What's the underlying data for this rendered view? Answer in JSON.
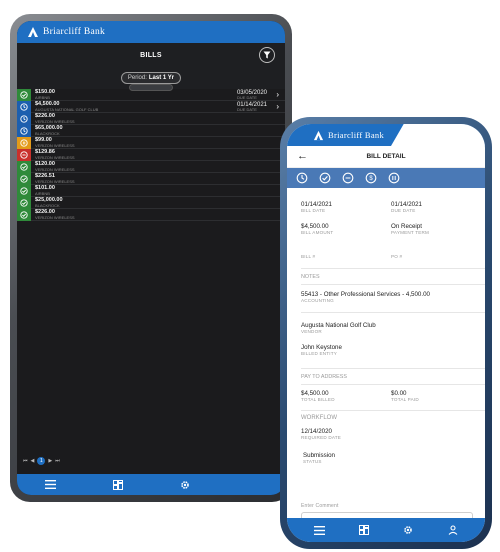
{
  "tablet": {
    "brand": "Briarcliff Bank",
    "title": "BILLS",
    "period": {
      "label": "Period:",
      "value": "Last 1 Yr"
    },
    "rows": [
      {
        "status": "approved",
        "amount": "$150.00",
        "vendor": "AIRBNB",
        "date": "03/05/2020",
        "date_label": "DUE DATE"
      },
      {
        "status": "pending",
        "amount": "$4,500.00",
        "vendor": "AUGUSTA NATIONAL GOLF CLUB",
        "date": "01/14/2021",
        "date_label": "DUE DATE"
      },
      {
        "status": "pending",
        "amount": "$226.00",
        "vendor": "VERIZON WIRELESS",
        "date": "",
        "date_label": ""
      },
      {
        "status": "pending",
        "amount": "$65,000.00",
        "vendor": "BLACKROCK",
        "date": "",
        "date_label": ""
      },
      {
        "status": "hold",
        "amount": "$99.00",
        "vendor": "VERIZON WIRELESS",
        "date": "",
        "date_label": ""
      },
      {
        "status": "rejected",
        "amount": "$129.86",
        "vendor": "VERIZON WIRELESS",
        "date": "",
        "date_label": ""
      },
      {
        "status": "approved",
        "amount": "$120.00",
        "vendor": "VERIZON WIRELESS",
        "date": "",
        "date_label": ""
      },
      {
        "status": "approved",
        "amount": "$226.51",
        "vendor": "VERIZON WIRELESS",
        "date": "",
        "date_label": ""
      },
      {
        "status": "approved",
        "amount": "$101.00",
        "vendor": "AIRBNB",
        "date": "",
        "date_label": ""
      },
      {
        "status": "approved",
        "amount": "$25,000.00",
        "vendor": "BLACKROCK",
        "date": "",
        "date_label": ""
      },
      {
        "status": "approved",
        "amount": "$226.00",
        "vendor": "VERIZON WIRELESS",
        "date": "",
        "date_label": ""
      }
    ],
    "pager": {
      "first": "⏮",
      "prev": "◀",
      "current": "1",
      "next": "▶",
      "last": "⏭"
    }
  },
  "colors": {
    "brand_blue": "#1f6fc2",
    "action_blue": "#4a79b6",
    "status_approved": "#2f8a3a",
    "status_pending": "#1d5fae",
    "status_hold": "#e39b1a",
    "status_rejected": "#c9302c"
  },
  "phone": {
    "brand": "Briarcliff Bank",
    "title": "BILL DETAIL",
    "bill_date": {
      "value": "01/14/2021",
      "label": "BILL DATE"
    },
    "due_date": {
      "value": "01/14/2021",
      "label": "DUE DATE"
    },
    "bill_amount": {
      "value": "$4,500.00",
      "label": "BILL AMOUNT"
    },
    "payment_term": {
      "value": "On Receipt",
      "label": "PAYMENT TERM"
    },
    "bill_number": {
      "label": "BILL #"
    },
    "po_number": {
      "label": "PO #"
    },
    "notes_label": "NOTES",
    "accounting": {
      "value": "55413 - Other Professional Services - 4,500.00",
      "label": "ACCOUNTING"
    },
    "vendor": {
      "value": "Augusta National Golf Club",
      "label": "VENDOR"
    },
    "billed_entity": {
      "value": "John Keystone",
      "label": "BILLED ENTITY"
    },
    "pay_to_label": "PAY TO ADDRESS",
    "total_billed": {
      "value": "$4,500.00",
      "label": "TOTAL BILLED"
    },
    "total_paid": {
      "value": "$0.00",
      "label": "TOTAL PAID"
    },
    "workflow_label": "WORKFLOW",
    "required_date": {
      "value": "12/14/2020",
      "label": "REQUIRED DATE"
    },
    "status": {
      "value": "Submission",
      "label": "STATUS"
    },
    "comment_placeholder": "Enter Comment"
  }
}
